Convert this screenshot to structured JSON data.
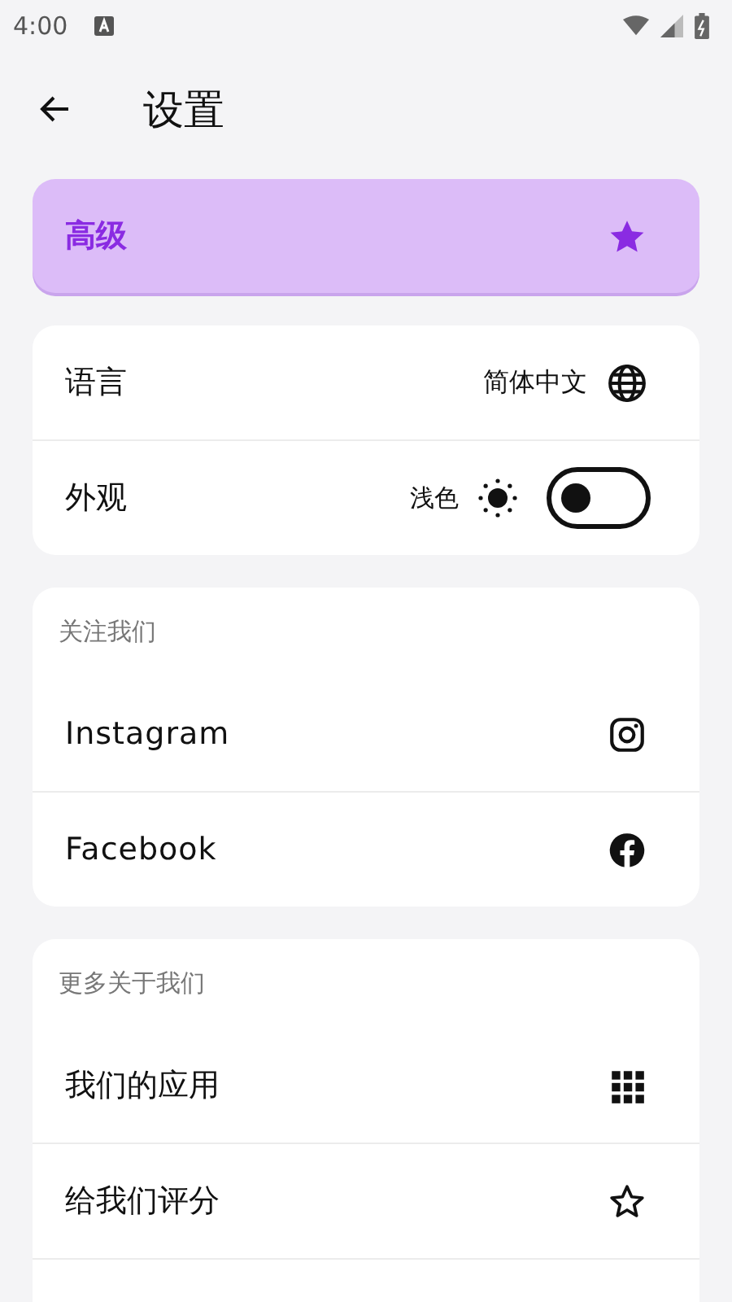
{
  "status_bar": {
    "time": "4:00"
  },
  "header": {
    "title": "设置"
  },
  "premium": {
    "label": "高级"
  },
  "general": [
    {
      "kind": "language",
      "label": "语言",
      "value": "简体中文"
    },
    {
      "kind": "theme",
      "label": "外观",
      "value": "浅色",
      "on": false
    }
  ],
  "follow": {
    "heading": "关注我们",
    "items": [
      {
        "kind": "instagram",
        "label": "Instagram"
      },
      {
        "kind": "facebook",
        "label": "Facebook"
      }
    ]
  },
  "more": {
    "heading": "更多关于我们",
    "items": [
      {
        "kind": "apps",
        "label": "我们的应用"
      },
      {
        "kind": "rate",
        "label": "给我们评分"
      }
    ]
  }
}
